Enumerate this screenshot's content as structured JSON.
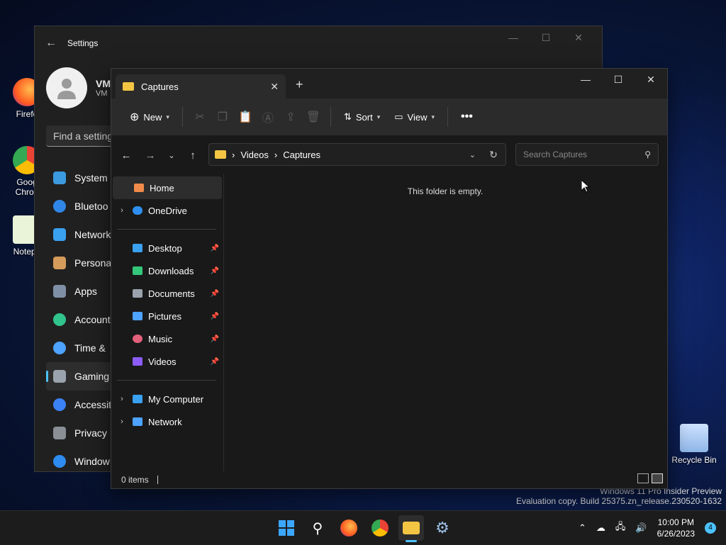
{
  "desktop": {
    "icons": [
      {
        "label": "Firefo"
      },
      {
        "label": "Goog Chron"
      },
      {
        "label": "Notepa"
      },
      {
        "label": "Recycle Bin"
      }
    ],
    "watermark_line1": "Windows 11 Pro Insider Preview",
    "watermark_line2": "Evaluation copy. Build 25375.zn_release.230520-1632"
  },
  "settings": {
    "title": "Settings",
    "profile_name": "VM",
    "profile_sub": "VM",
    "search_placeholder": "Find a setting",
    "nav": [
      {
        "label": "System",
        "color": "#3b9ae0"
      },
      {
        "label": "Bluetoo",
        "color": "#2f86e6"
      },
      {
        "label": "Network",
        "color": "#3aa0f0"
      },
      {
        "label": "Persona",
        "color": "#d49b5a"
      },
      {
        "label": "Apps",
        "color": "#7f8fa6"
      },
      {
        "label": "Account",
        "color": "#31c48d"
      },
      {
        "label": "Time &",
        "color": "#4da3ff"
      },
      {
        "label": "Gaming",
        "color": "#9aa3ad"
      },
      {
        "label": "Accessit",
        "color": "#3b82f6"
      },
      {
        "label": "Privacy",
        "color": "#8a8f96"
      },
      {
        "label": "Window",
        "color": "#2e8cf0"
      }
    ]
  },
  "explorer": {
    "tab_title": "Captures",
    "commands": {
      "new_label": "New",
      "sort_label": "Sort",
      "view_label": "View"
    },
    "breadcrumb": [
      "Videos",
      "Captures"
    ],
    "search_placeholder": "Search Captures",
    "nav": {
      "home": "Home",
      "onedrive": "OneDrive",
      "pinned": [
        {
          "label": "Desktop",
          "color": "#3aa0f0"
        },
        {
          "label": "Downloads",
          "color": "#34c77b"
        },
        {
          "label": "Documents",
          "color": "#9aa3ad"
        },
        {
          "label": "Pictures",
          "color": "#4da3ff"
        },
        {
          "label": "Music",
          "color": "#e2607a"
        },
        {
          "label": "Videos",
          "color": "#8b5cf6"
        }
      ],
      "my_computer": "My Computer",
      "network": "Network"
    },
    "empty_message": "This folder is empty.",
    "status": "0 items"
  },
  "taskbar": {
    "time": "10:00 PM",
    "date": "6/26/2023",
    "notifications": "4"
  }
}
